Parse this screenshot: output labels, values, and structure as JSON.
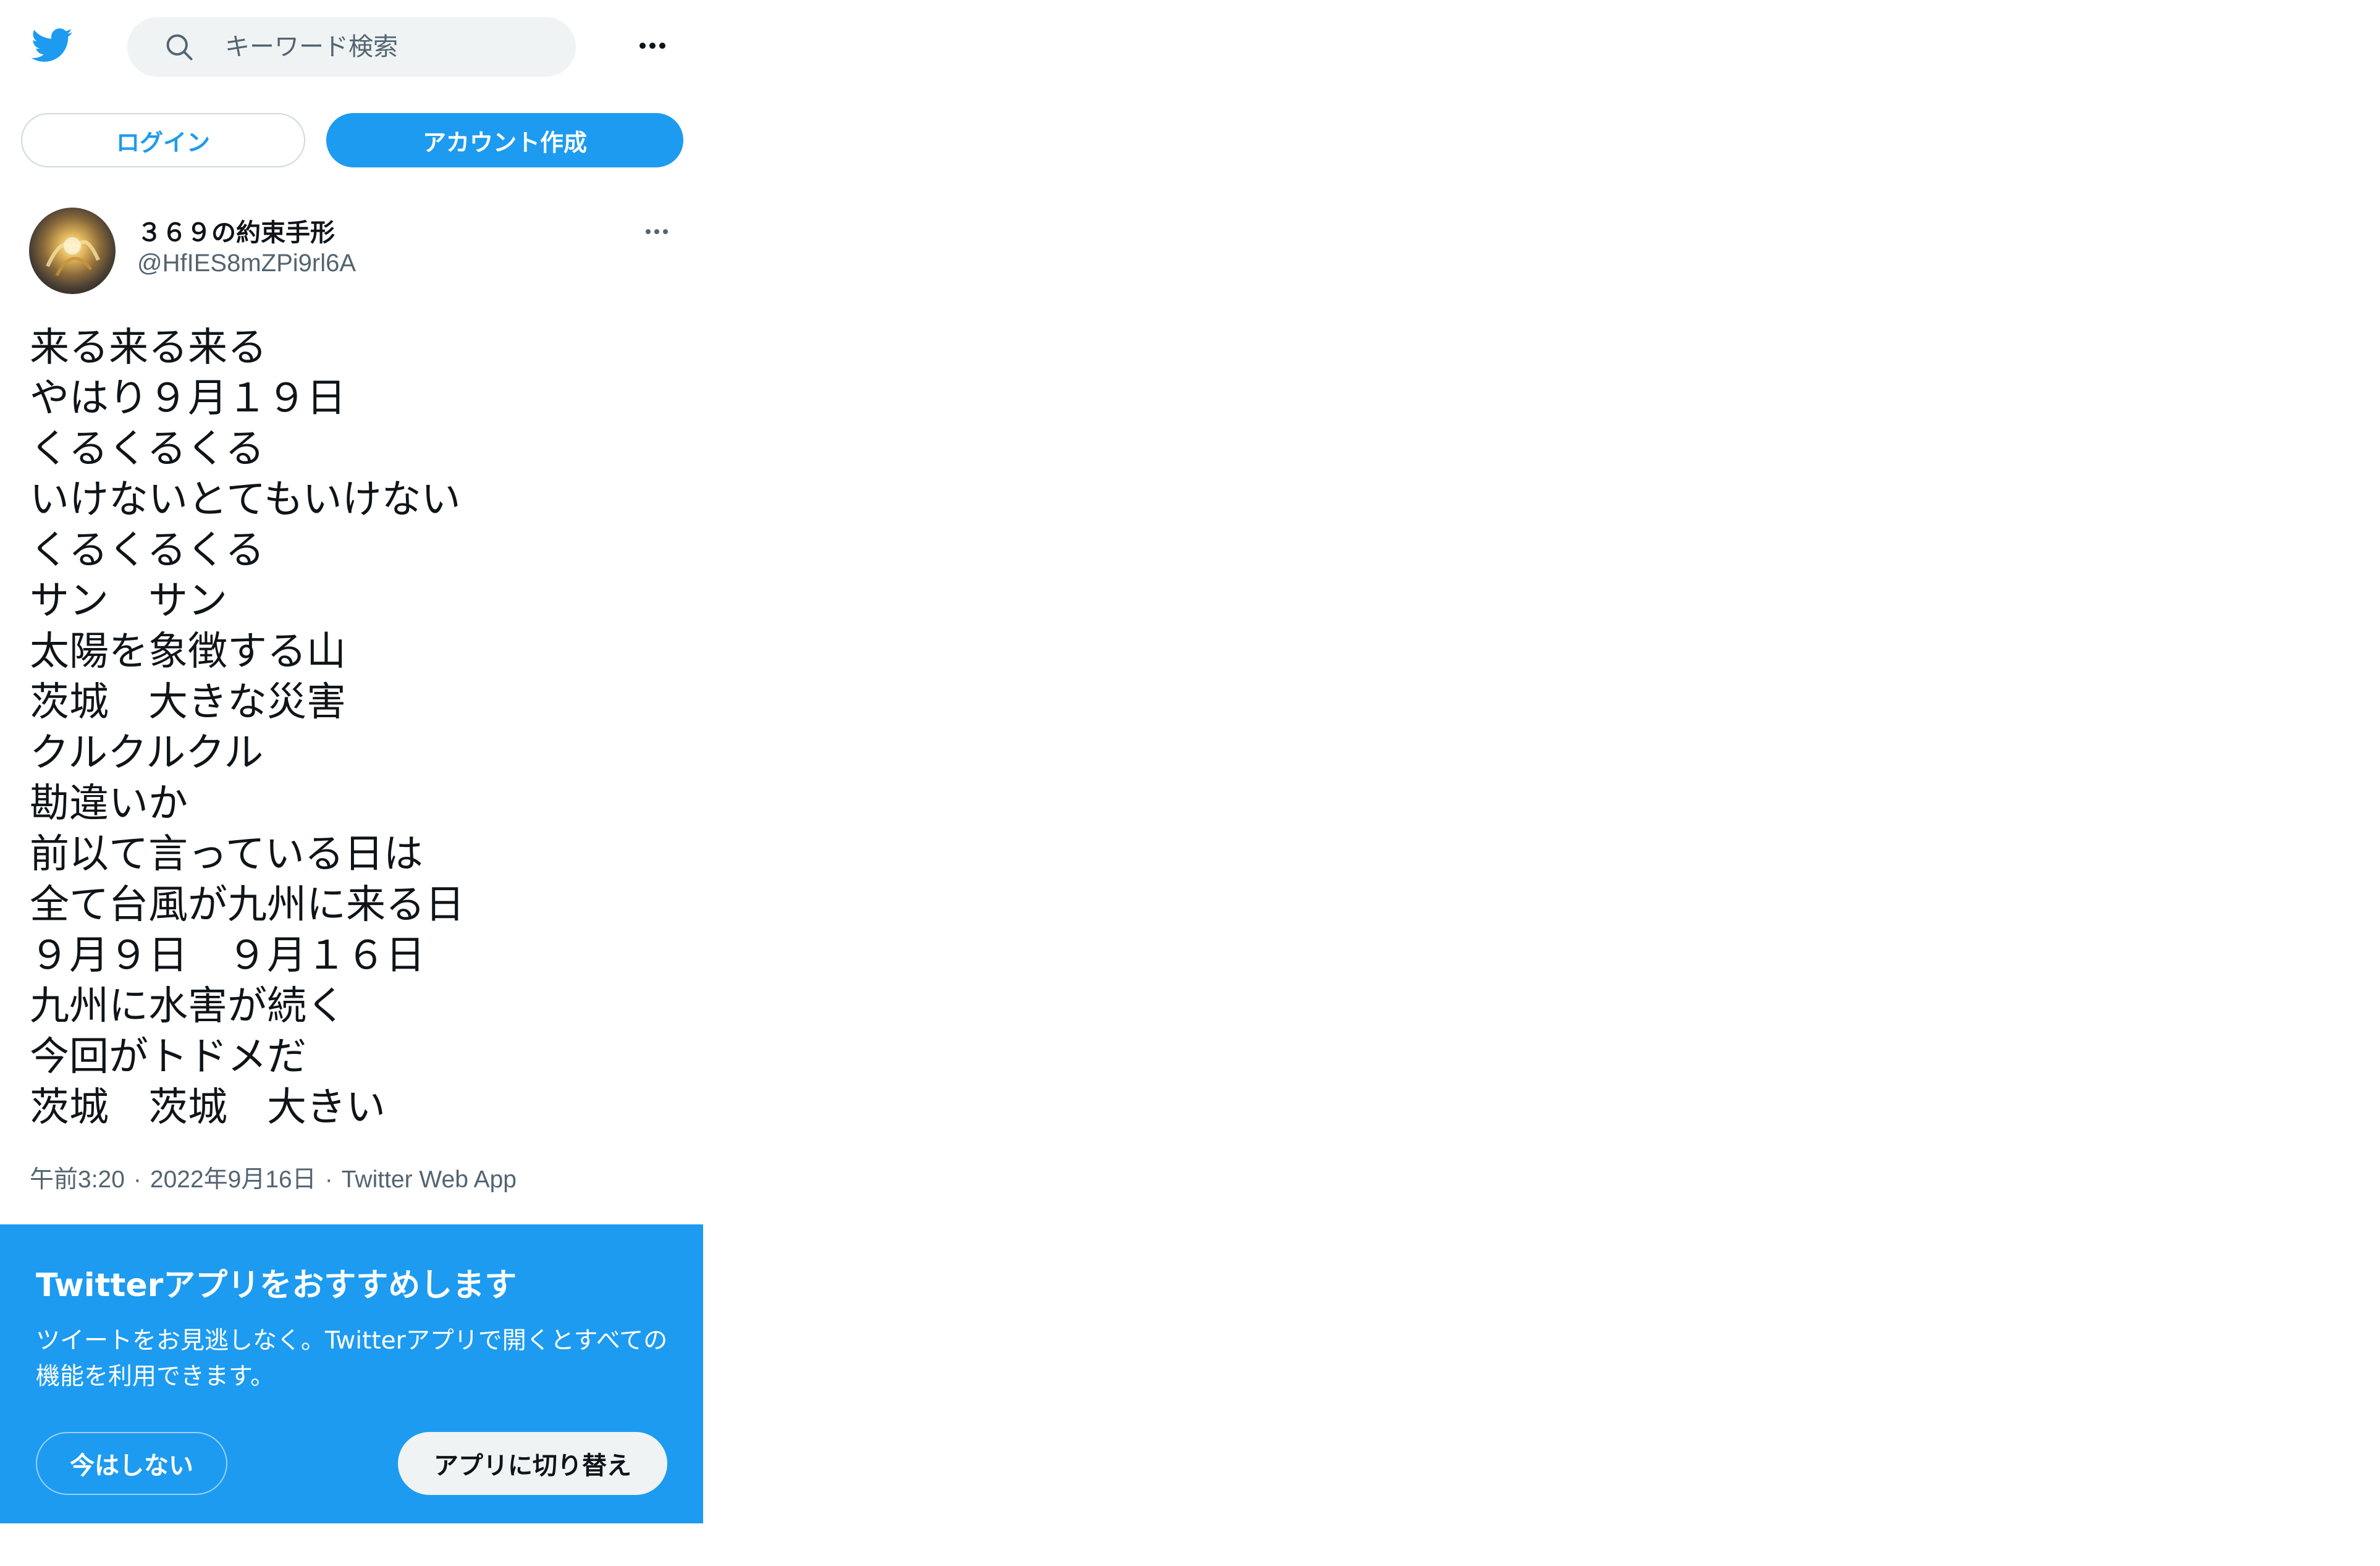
{
  "header": {
    "logo_icon": "twitter-bird-icon",
    "search_icon": "search-icon",
    "search_placeholder": "キーワード検索",
    "more_icon": "more-horizontal-icon"
  },
  "auth": {
    "login_label": "ログイン",
    "signup_label": "アカウント作成"
  },
  "tweet": {
    "avatar_icon": "avatar",
    "display_name": "３６９の約束手形",
    "handle": "@HfIES8mZPi9rl6A",
    "lines": [
      "来る来る来る",
      "やはり９月１９日",
      "くるくるくる",
      "いけないとてもいけない",
      "くるくるくる",
      "サン　サン",
      "太陽を象徴する山",
      "茨城　大きな災害",
      "クルクルクル",
      "勘違いか",
      "前以て言っている日は",
      "全て台風が九州に来る日",
      "９月９日　９月１６日",
      "九州に水害が続く",
      "今回がトドメだ",
      "茨城　茨城　大きい"
    ],
    "time": "午前3:20",
    "date": "2022年9月16日",
    "separator": "·",
    "source": "Twitter Web App"
  },
  "banner": {
    "title": "Twitterアプリをおすすめします",
    "body": "ツイートをお見逃しなく。Twitterアプリで開くとすべての機能を利用できます。",
    "not_now_label": "今はしない",
    "switch_label": "アプリに切り替え"
  },
  "colors": {
    "brand": "#1d9bf0",
    "text": "#0f1419",
    "secondary": "#536471",
    "search_bg": "#eff3f4"
  }
}
